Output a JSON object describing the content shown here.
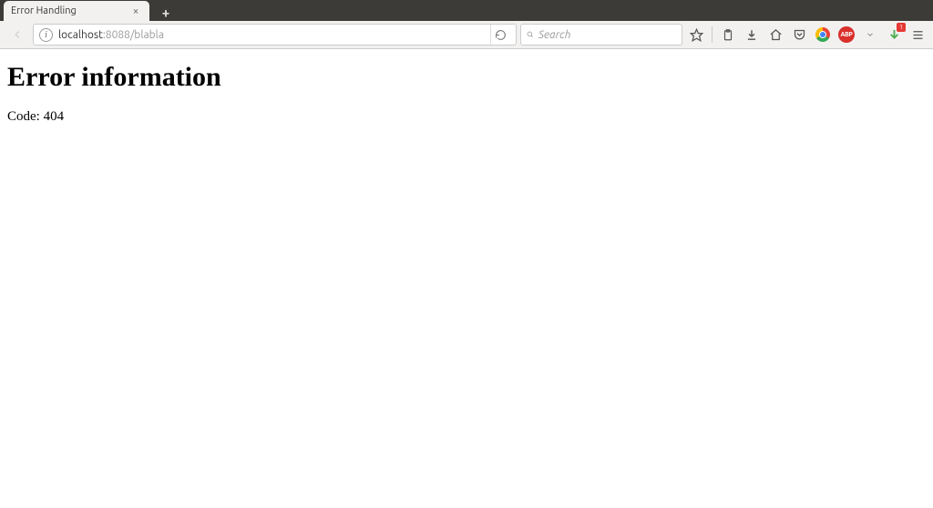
{
  "tab": {
    "title": "Error Handling"
  },
  "url": {
    "host": "localhost",
    "port_path": ":8088/blabla"
  },
  "search": {
    "placeholder": "Search"
  },
  "downloads": {
    "badge": "1"
  },
  "abp": {
    "label": "ABP"
  },
  "page": {
    "heading": "Error information",
    "code_line": "Code: 404"
  }
}
